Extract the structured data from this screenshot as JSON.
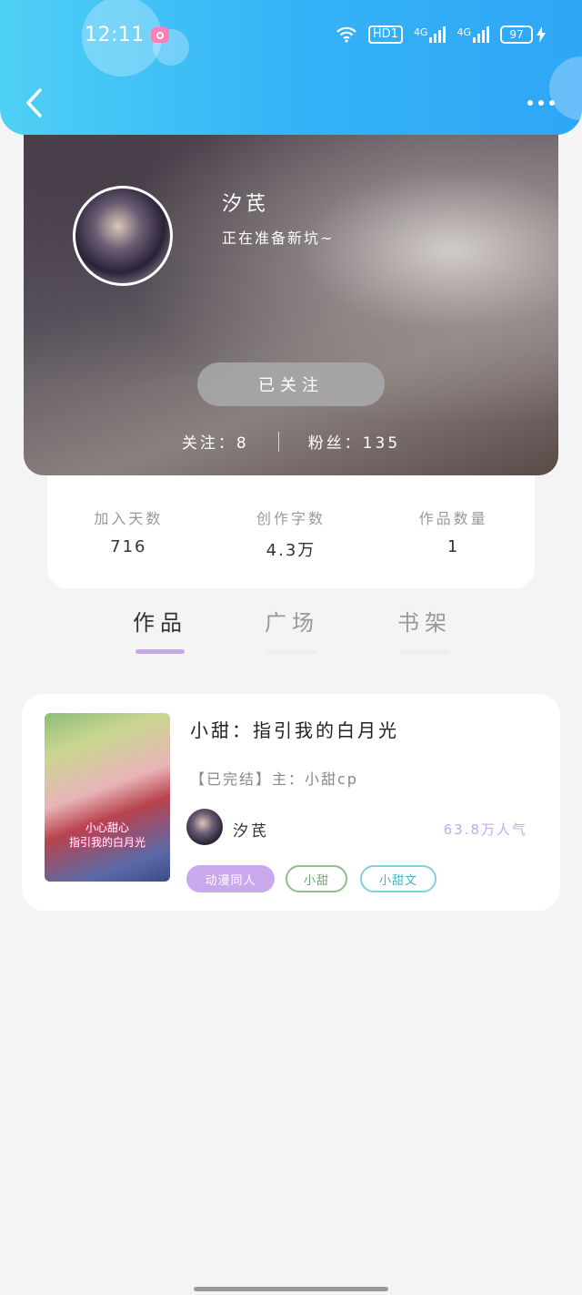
{
  "status_bar": {
    "time": "12:11",
    "network_hd": "HD1",
    "signal1": "4G",
    "signal2": "4G",
    "battery": "97"
  },
  "header": {
    "back_icon": "chevron-left-icon",
    "more_icon": "more-dots-icon"
  },
  "profile": {
    "username": "汐芪",
    "bio": "正在准备新坑~",
    "follow_button": "已关注",
    "following_text": "关注：8",
    "followers_text": "粉丝：135"
  },
  "stats": [
    {
      "label": "加入天数",
      "value": "716"
    },
    {
      "label": "创作字数",
      "value": "4.3万"
    },
    {
      "label": "作品数量",
      "value": "1"
    }
  ],
  "tabs": [
    {
      "label": "作品",
      "active": true
    },
    {
      "label": "广场",
      "active": false
    },
    {
      "label": "书架",
      "active": false
    }
  ],
  "work": {
    "title": "小甜：指引我的白月光",
    "meta": "【已完结】主：小甜cp",
    "cover_text": "小心甜心\n指引我的白月光",
    "author": "汐芪",
    "popularity": "63.8万人气",
    "tags": [
      "动漫同人",
      "小甜",
      "小甜文"
    ]
  },
  "colors": {
    "header_start": "#4fd0f5",
    "header_end": "#2ea6f6",
    "accent_purple": "#c9a9ee"
  }
}
